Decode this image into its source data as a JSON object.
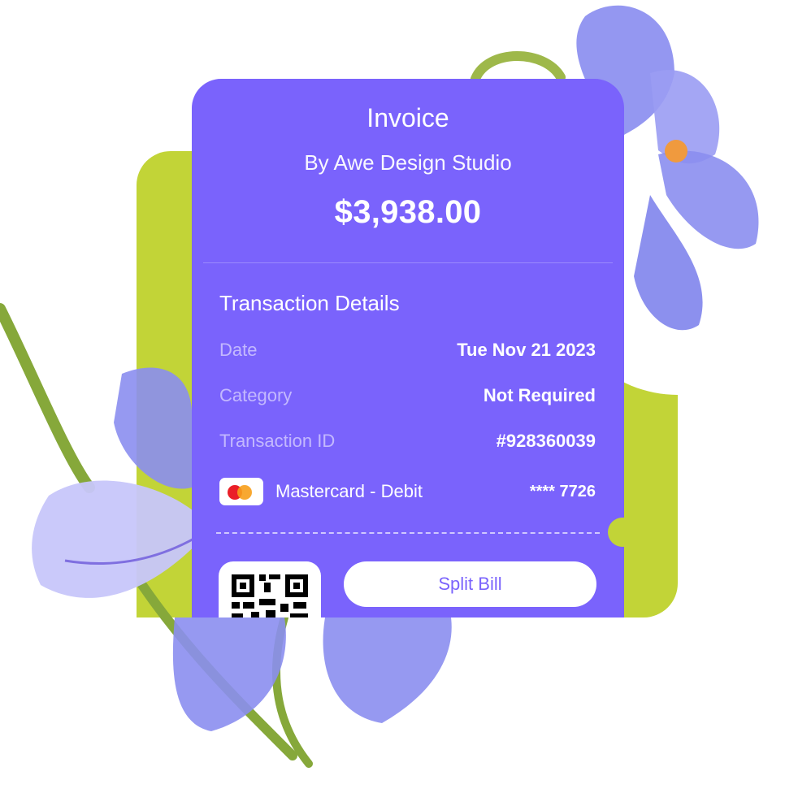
{
  "invoice": {
    "title": "Invoice",
    "subtitle": "By Awe Design Studio",
    "amount": "$3,938.00"
  },
  "details": {
    "section_title": "Transaction Details",
    "rows": [
      {
        "label": "Date",
        "value": "Tue Nov 21 2023"
      },
      {
        "label": "Category",
        "value": "Not Required"
      },
      {
        "label": "Transaction ID",
        "value": "#928360039"
      }
    ]
  },
  "payment": {
    "method": "Mastercard - Debit",
    "card_number": "**** 7726",
    "icon": "mastercard-icon"
  },
  "actions": {
    "split_bill_label": "Split Bill"
  },
  "colors": {
    "card_purple": "#7a63fc",
    "accent_green": "#c2d437",
    "flower_violet": "#8b8ef0",
    "stem_green": "#86a83a"
  }
}
